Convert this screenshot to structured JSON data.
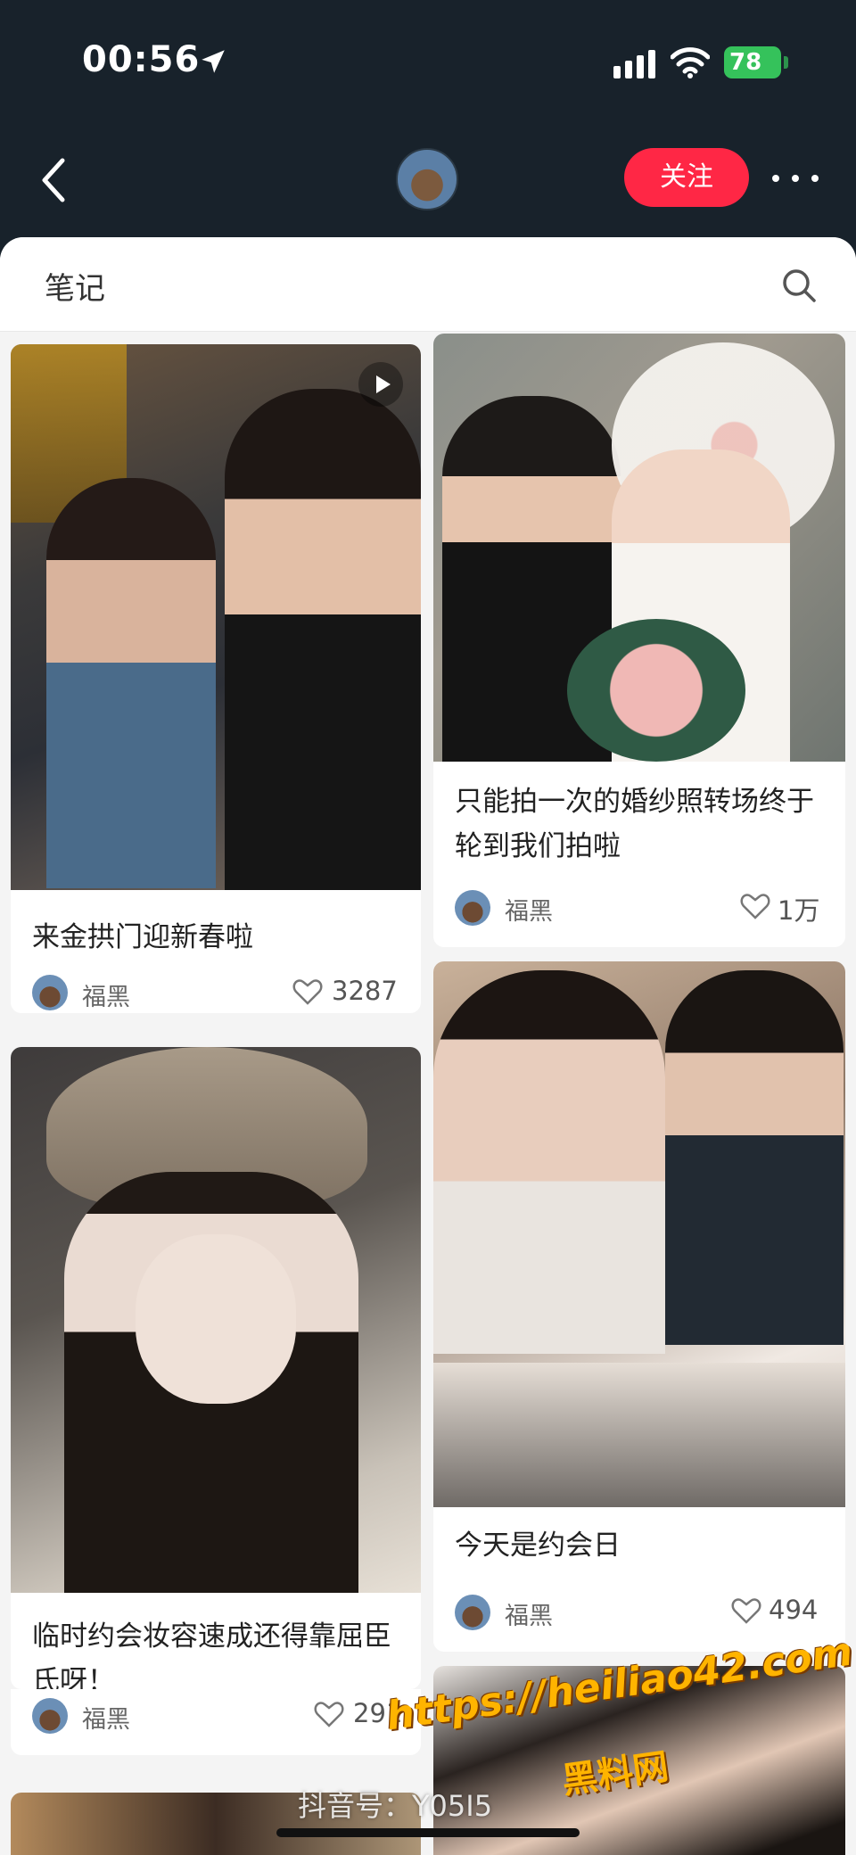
{
  "status_bar": {
    "time": "00:56",
    "battery": "78"
  },
  "header": {
    "follow_label": "关注"
  },
  "tabs": {
    "notes": "笔记"
  },
  "notes": [
    {
      "title": "来金拱门迎新春啦",
      "author": "福黑",
      "likes": "3287",
      "has_video": true
    },
    {
      "title": "只能拍一次的婚纱照转场终于轮到我们拍啦",
      "author": "福黑",
      "likes": "1万",
      "has_video": false
    },
    {
      "title": "临时约会妆容速成还得靠屈臣氏呀！",
      "author": "福黑",
      "likes": "291",
      "has_video": false
    },
    {
      "title": "今天是约会日",
      "author": "福黑",
      "likes": "494",
      "has_video": false
    }
  ],
  "watermark": {
    "douyin": "抖音号：Y05I5",
    "url": "https://heiliao42.com",
    "site": "黑料网"
  },
  "colors": {
    "accent": "#ff2745",
    "header_bg": "#18222b",
    "battery": "#35c25b"
  },
  "icons": [
    "back-icon",
    "location-arrow-icon",
    "signal-icon",
    "wifi-icon",
    "battery-icon",
    "more-icon",
    "search-icon",
    "play-icon",
    "heart-icon"
  ]
}
